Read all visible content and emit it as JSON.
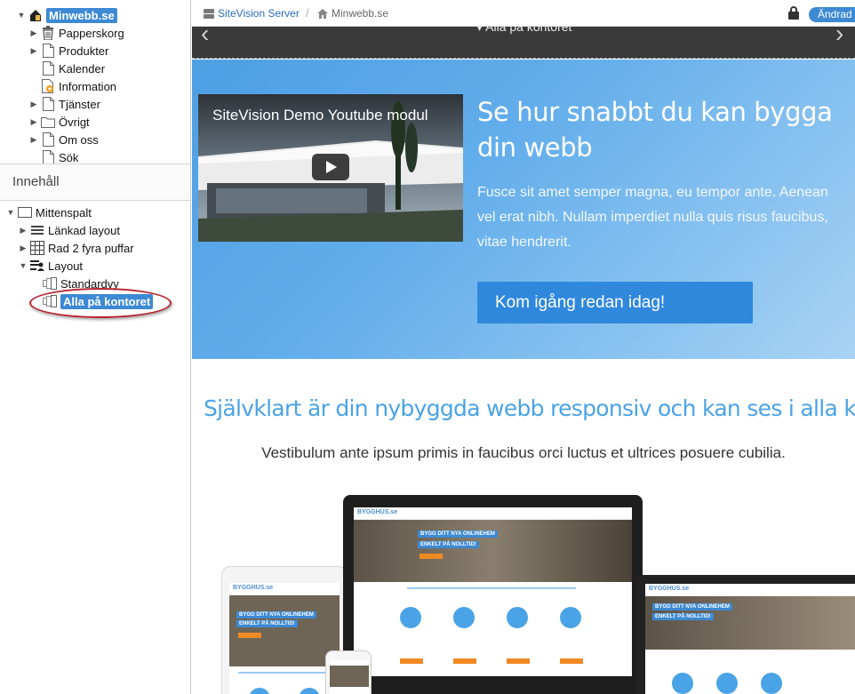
{
  "left_panel": {
    "site_tree": [
      {
        "label": "Minwebb.se",
        "icon": "site-icon",
        "expanded": true,
        "selected": true,
        "level": 0
      },
      {
        "label": "Papperskorg",
        "icon": "trash-icon",
        "expanded": false,
        "level": 1
      },
      {
        "label": "Produkter",
        "icon": "page-icon",
        "expanded": false,
        "level": 1
      },
      {
        "label": "Kalender",
        "icon": "page-icon",
        "level": 1
      },
      {
        "label": "Information",
        "icon": "page-orange-icon",
        "level": 1
      },
      {
        "label": "Tjänster",
        "icon": "page-icon",
        "expanded": false,
        "level": 1
      },
      {
        "label": "Övrigt",
        "icon": "folder-icon",
        "expanded": false,
        "level": 1
      },
      {
        "label": "Om oss",
        "icon": "page-icon",
        "expanded": false,
        "level": 1
      },
      {
        "label": "Sök",
        "icon": "page-icon",
        "level": 1
      }
    ],
    "content_header": "Innehåll",
    "content_tree": [
      {
        "label": "Mittenspalt",
        "icon": "column-icon",
        "expanded": true,
        "level": 0
      },
      {
        "label": "Länkad layout",
        "icon": "linked-layout-icon",
        "expanded": false,
        "level": 1
      },
      {
        "label": "Rad 2 fyra puffar",
        "icon": "grid-icon",
        "expanded": false,
        "level": 1
      },
      {
        "label": "Layout",
        "icon": "layout-icon",
        "expanded": true,
        "level": 1
      },
      {
        "label": "Standardvy",
        "icon": "view-icon",
        "level": 2
      },
      {
        "label": "Alla på kontoret",
        "icon": "view-icon",
        "selected": true,
        "level": 2
      }
    ]
  },
  "topbar": {
    "breadcrumb_server": "SiteVision Server",
    "breadcrumb_separator": "/",
    "breadcrumb_site": "Minwebb.se",
    "edit_label": "Ändrad"
  },
  "preview": {
    "slider_label": "▾ Alla på kontoret",
    "video_title": "SiteVision Demo Youtube modul",
    "hero_title": "Se hur snabbt du kan bygga din webb",
    "hero_text": "Fusce sit amet semper magna, eu tempor ante. Aenean vel erat nibh. Nullam imperdiet nulla quis risus faucibus, vitae hendrerit.",
    "cta_label": "Kom igång redan idag!",
    "section_title": "Självklart är din nybyggda webb responsiv och kan ses i alla kanaler",
    "section_text": "Vestibulum ante ipsum primis in faucibus orci luctus et ultrices posuere cubilia.",
    "mock_logo": "BYGGHUS.se",
    "mock_banner_1": "BYGG DITT NYA ONLINEHEM",
    "mock_banner_2": "ENKELT PÅ NOLLTID!"
  },
  "colors": {
    "accent": "#3d89d4",
    "hero_blue": "#5aa6e6",
    "cta_blue": "#2f88dc",
    "section_title": "#4aa3e6",
    "annotation_red": "#b8232e"
  }
}
